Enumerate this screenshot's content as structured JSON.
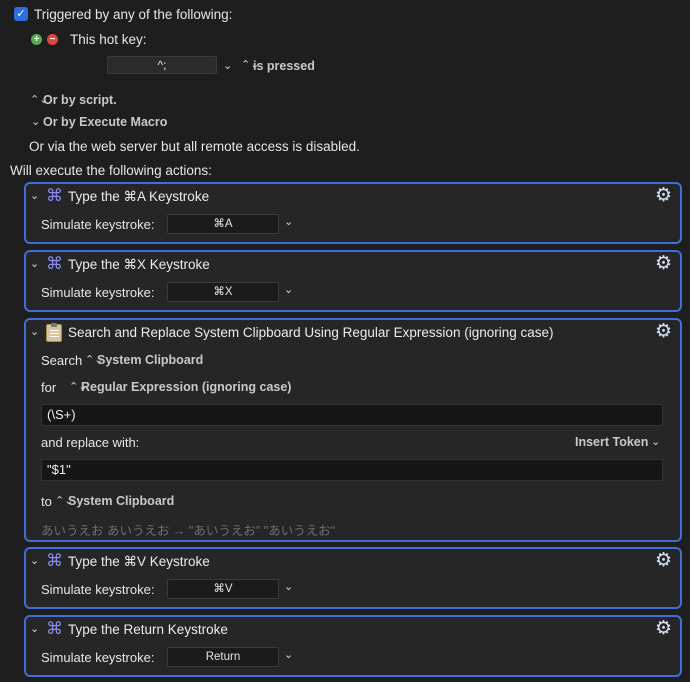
{
  "trigger": {
    "checkbox_checked": true,
    "title": "Triggered by any of the following:",
    "hotkey_label": "This hot key:",
    "hotkey_value": "^;",
    "hotkey_state": "is pressed",
    "or_script": "Or by script.",
    "or_execute_macro": "Or by Execute Macro",
    "web_server_note": "Or via the web server but all remote access is disabled."
  },
  "actions_header": "Will execute the following actions:",
  "actions": {
    "a1": {
      "title": "Type the ⌘A Keystroke",
      "sim_label": "Simulate keystroke:",
      "keystroke": "⌘A"
    },
    "a2": {
      "title": "Type the ⌘X Keystroke",
      "sim_label": "Simulate keystroke:",
      "keystroke": "⌘X"
    },
    "search": {
      "title": "Search and Replace System Clipboard Using Regular Expression (ignoring case)",
      "search_label": "Search",
      "search_source": "System Clipboard",
      "for_label": "for",
      "mode": "Regular Expression (ignoring case)",
      "pattern": "(\\S+)",
      "replace_label": "and replace with:",
      "insert_token": "Insert Token",
      "replacement": "\"$1\"",
      "to_label": "to",
      "to_target": "System Clipboard",
      "preview": "あいうえお あいうえお → \"あいうえお\" \"あいうえお\""
    },
    "a3": {
      "title": "Type the ⌘V Keystroke",
      "sim_label": "Simulate keystroke:",
      "keystroke": "⌘V"
    },
    "a4": {
      "title": "Type the Return Keystroke",
      "sim_label": "Simulate keystroke:",
      "keystroke": "Return"
    }
  },
  "icons": {
    "command": "command-icon",
    "gear": "gear-icon",
    "clipboard": "clipboard-icon",
    "chevron": "chevron-down-icon",
    "updown": "updown-chevron-icon"
  },
  "colors": {
    "accent": "#3f6fd6",
    "checkbox": "#2f6ee0",
    "add": "#4caf50",
    "remove": "#e0463e",
    "command_icon": "#8a8cf0"
  }
}
